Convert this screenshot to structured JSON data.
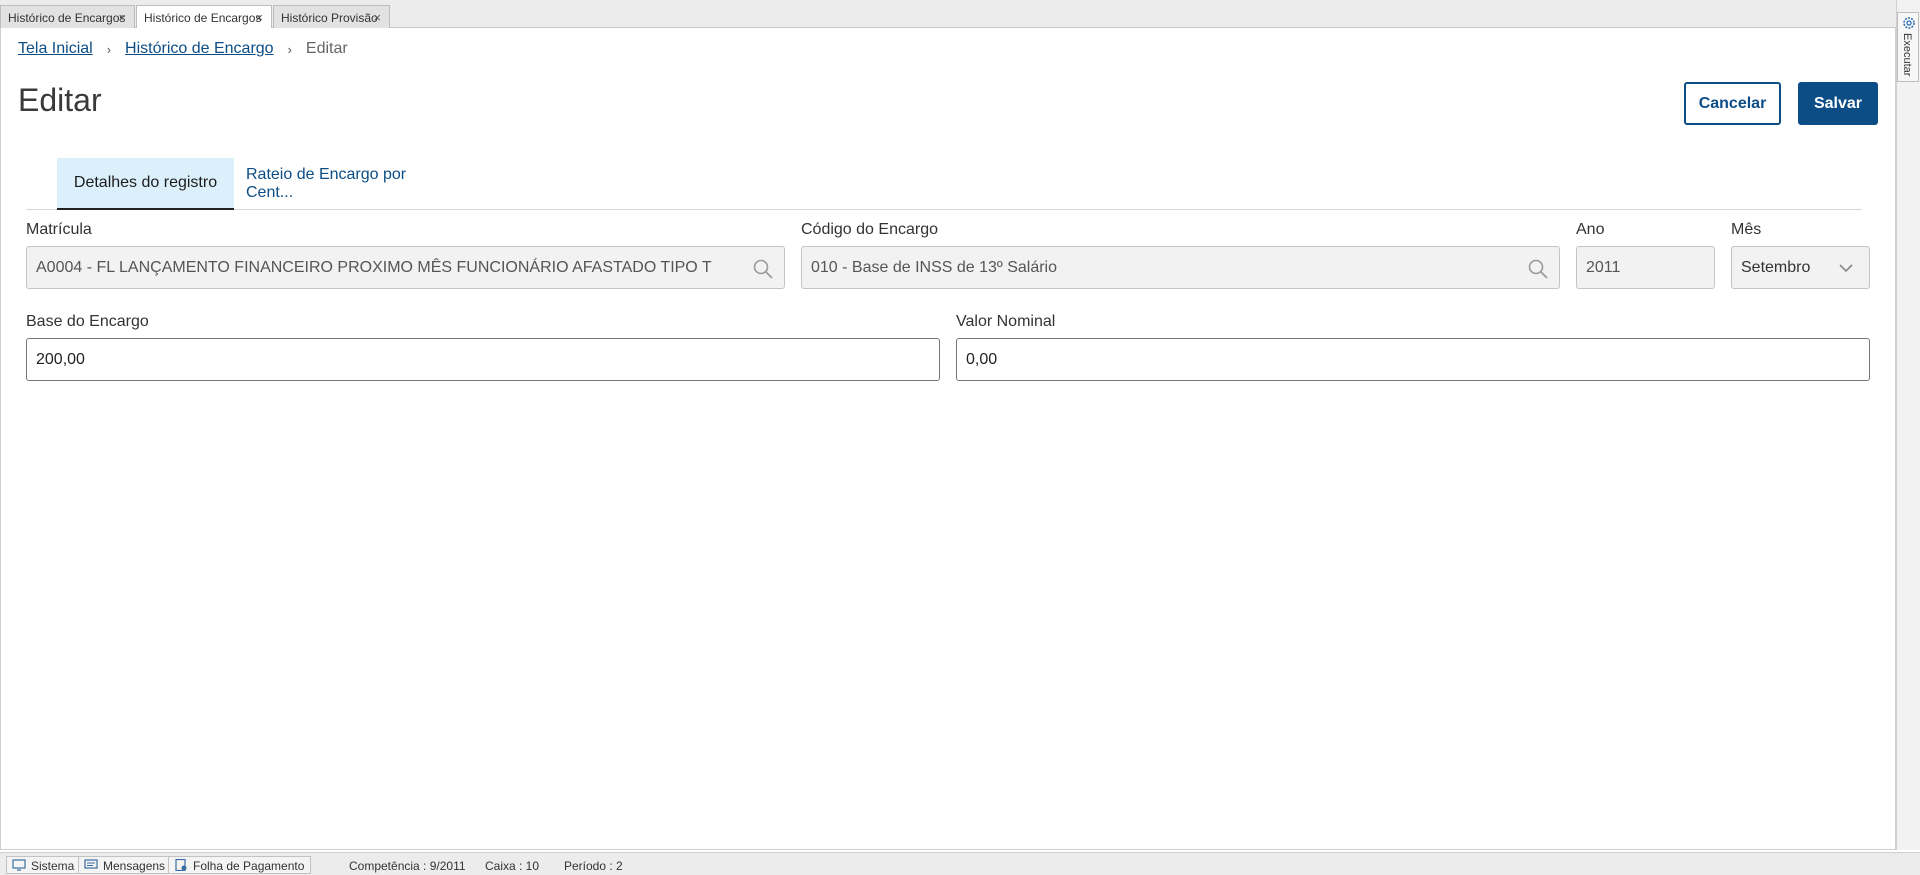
{
  "doc_tabs": [
    {
      "label": "Histórico de Encargos",
      "close": "×"
    },
    {
      "label": "Histórico de Encargos",
      "close": "×"
    },
    {
      "label": "Histórico Provisão",
      "close": "×"
    }
  ],
  "side": {
    "executar_label": "Executar"
  },
  "breadcrumb": {
    "home": "Tela Inicial",
    "parent": "Histórico de Encargo",
    "current": "Editar",
    "separator": "›"
  },
  "page": {
    "title": "Editar"
  },
  "actions": {
    "cancel_label": "Cancelar",
    "save_label": "Salvar"
  },
  "tabs": [
    {
      "label": "Detalhes do registro"
    },
    {
      "label": "Rateio de Encargo por Cent..."
    }
  ],
  "form": {
    "matricula": {
      "label": "Matrícula",
      "value": "A0004 - FL LANÇAMENTO FINANCEIRO PROXIMO MÊS FUNCIONÁRIO AFASTADO TIPO T"
    },
    "codigo": {
      "label": "Código do Encargo",
      "value": "010 - Base de INSS de 13º Salário"
    },
    "ano": {
      "label": "Ano",
      "value": "2011"
    },
    "mes": {
      "label": "Mês",
      "value": "Setembro"
    },
    "base": {
      "label": "Base do Encargo",
      "value": "200,00"
    },
    "valor": {
      "label": "Valor Nominal",
      "value": "0,00"
    }
  },
  "status_bar": {
    "sistema": "Sistema",
    "mensagens": "Mensagens",
    "folha": "Folha de Pagamento",
    "competencia": "Competência : 9/2011",
    "caixa": "Caixa : 10",
    "periodo": "Período : 2"
  },
  "colors": {
    "accent": "#0c4d86",
    "tab_active_bg": "#dcf0fb"
  }
}
